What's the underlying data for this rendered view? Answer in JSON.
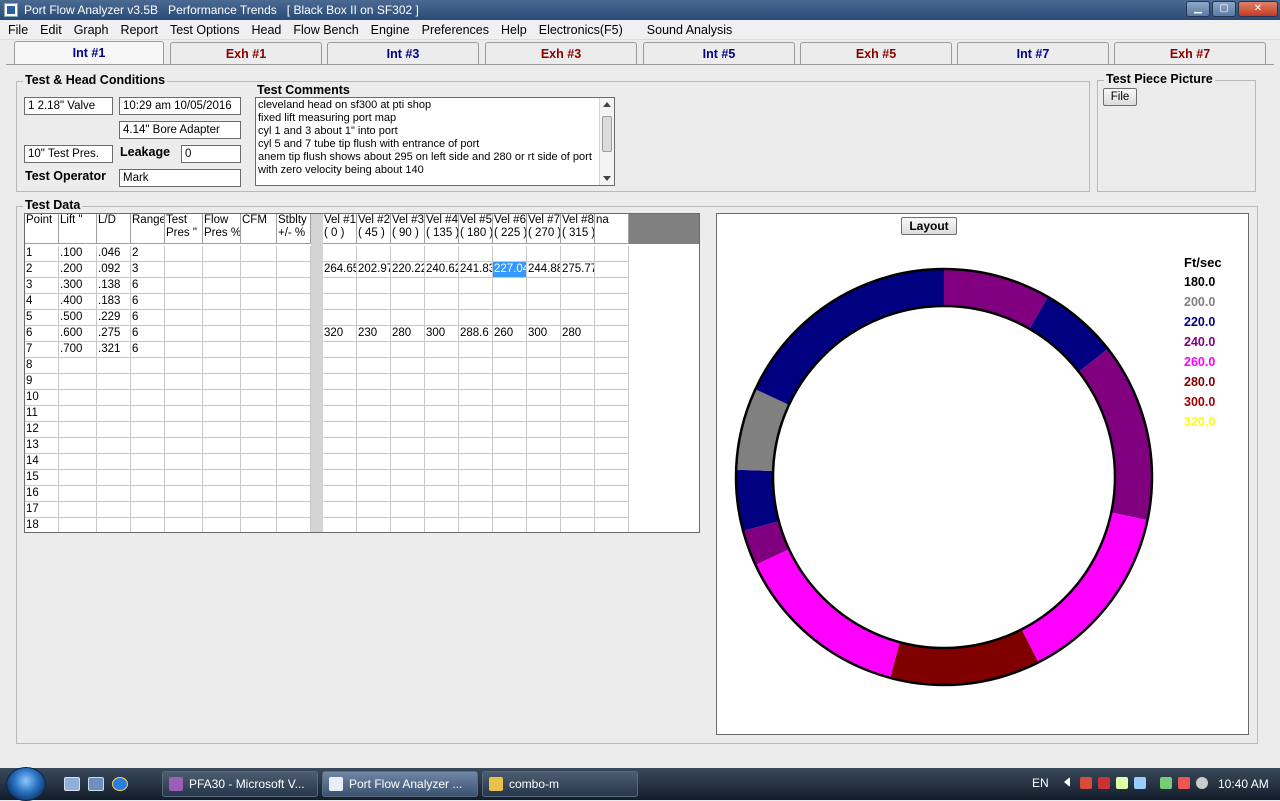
{
  "window": {
    "title": "Port Flow Analyzer v3.5B   Performance Trends   [ Black Box II on SF302 ]",
    "controls": {
      "minimize": "▁",
      "maximize": "▢",
      "close": "✕"
    }
  },
  "menu": [
    "File",
    "Edit",
    "Graph",
    "Report",
    "Test Options",
    "Head",
    "Flow Bench",
    "Engine",
    "Preferences",
    "Help",
    "Electronics(F5)",
    "Sound Analysis"
  ],
  "tabs": [
    {
      "label": "Int #1",
      "kind": "int"
    },
    {
      "label": "Exh #1",
      "kind": "exh"
    },
    {
      "label": "Int #3",
      "kind": "int"
    },
    {
      "label": "Exh #3",
      "kind": "exh"
    },
    {
      "label": "Int #5",
      "kind": "int"
    },
    {
      "label": "Exh #5",
      "kind": "exh"
    },
    {
      "label": "Int #7",
      "kind": "int"
    },
    {
      "label": "Exh #7",
      "kind": "exh"
    }
  ],
  "active_tab": "Int #1",
  "conditions": {
    "title": "Test & Head Conditions",
    "valve": "1  2.18\" Valve",
    "datetime": "10:29 am  10/05/2016",
    "bore_adapter": "4.14\" Bore Adapter",
    "test_pres": "10\" Test Pres.",
    "leakage_label": "Leakage",
    "leakage_value": "0",
    "operator_label": "Test Operator",
    "operator": "Mark"
  },
  "comments": {
    "title": "Test Comments",
    "lines": [
      "cleveland head on sf300 at pti shop",
      "fixed lift measuring port map",
      "cyl 1 and 3 about 1\" into port",
      "cyl 5 and 7 tube tip flush with entrance of port",
      "anem tip flush shows about 295 on left side and 280 or rt side of port",
      "with zero velocity being about 140"
    ]
  },
  "picture": {
    "title": "Test Piece Picture",
    "file_button": "File"
  },
  "test_data": {
    "title": "Test Data",
    "headers": [
      "Point",
      "Lift \"",
      "L/D",
      "Range",
      "Test\nPres \"",
      "Flow\nPres %",
      "CFM",
      "Stblty\n+/- %",
      "",
      "Vel #1\n( 0 )",
      "Vel #2\n( 45 )",
      "Vel #3\n( 90 )",
      "Vel #4\n( 135 )",
      "Vel #5\n( 180 )",
      "Vel #6\n( 225 )",
      "Vel #7\n( 270 )",
      "Vel #8\n( 315 )",
      "na"
    ],
    "rows": [
      [
        "1",
        ".100",
        ".046",
        "2",
        "",
        "",
        "",
        "",
        "",
        "",
        "",
        "",
        "",
        "",
        "",
        "",
        "",
        ""
      ],
      [
        "2",
        ".200",
        ".092",
        "3",
        "",
        "",
        "",
        "",
        "",
        "264.65",
        "202.97",
        "220.22",
        "240.62",
        "241.83",
        "227.04",
        "244.88",
        "275.77",
        ""
      ],
      [
        "3",
        ".300",
        ".138",
        "6",
        "",
        "",
        "",
        "",
        "",
        "",
        "",
        "",
        "",
        "",
        "",
        "",
        "",
        ""
      ],
      [
        "4",
        ".400",
        ".183",
        "6",
        "",
        "",
        "",
        "",
        "",
        "",
        "",
        "",
        "",
        "",
        "",
        "",
        "",
        ""
      ],
      [
        "5",
        ".500",
        ".229",
        "6",
        "",
        "",
        "",
        "",
        "",
        "",
        "",
        "",
        "",
        "",
        "",
        "",
        "",
        ""
      ],
      [
        "6",
        ".600",
        ".275",
        "6",
        "",
        "",
        "",
        "",
        "",
        "320",
        "230",
        "280",
        "300",
        "288.6",
        "260",
        "300",
        "280",
        ""
      ],
      [
        "7",
        ".700",
        ".321",
        "6",
        "",
        "",
        "",
        "",
        "",
        "",
        "",
        "",
        "",
        "",
        "",
        "",
        "",
        ""
      ],
      [
        "8",
        "",
        "",
        "",
        "",
        "",
        "",
        "",
        "",
        "",
        "",
        "",
        "",
        "",
        "",
        "",
        "",
        ""
      ],
      [
        "9",
        "",
        "",
        "",
        "",
        "",
        "",
        "",
        "",
        "",
        "",
        "",
        "",
        "",
        "",
        "",
        "",
        ""
      ],
      [
        "10",
        "",
        "",
        "",
        "",
        "",
        "",
        "",
        "",
        "",
        "",
        "",
        "",
        "",
        "",
        "",
        "",
        ""
      ],
      [
        "11",
        "",
        "",
        "",
        "",
        "",
        "",
        "",
        "",
        "",
        "",
        "",
        "",
        "",
        "",
        "",
        "",
        ""
      ],
      [
        "12",
        "",
        "",
        "",
        "",
        "",
        "",
        "",
        "",
        "",
        "",
        "",
        "",
        "",
        "",
        "",
        "",
        ""
      ],
      [
        "13",
        "",
        "",
        "",
        "",
        "",
        "",
        "",
        "",
        "",
        "",
        "",
        "",
        "",
        "",
        "",
        "",
        ""
      ],
      [
        "14",
        "",
        "",
        "",
        "",
        "",
        "",
        "",
        "",
        "",
        "",
        "",
        "",
        "",
        "",
        "",
        "",
        ""
      ],
      [
        "15",
        "",
        "",
        "",
        "",
        "",
        "",
        "",
        "",
        "",
        "",
        "",
        "",
        "",
        "",
        "",
        "",
        ""
      ],
      [
        "16",
        "",
        "",
        "",
        "",
        "",
        "",
        "",
        "",
        "",
        "",
        "",
        "",
        "",
        "",
        "",
        "",
        ""
      ],
      [
        "17",
        "",
        "",
        "",
        "",
        "",
        "",
        "",
        "",
        "",
        "",
        "",
        "",
        "",
        "",
        "",
        "",
        ""
      ],
      [
        "18",
        "",
        "",
        "",
        "",
        "",
        "",
        "",
        "",
        "",
        "",
        "",
        "",
        "",
        "",
        "",
        "",
        ""
      ]
    ],
    "selected_cell": {
      "row": 2,
      "column": "Vel #6"
    }
  },
  "port_map": {
    "layout_button": "Layout",
    "legend_title": "Ft/sec",
    "legend": [
      {
        "value": "180.0",
        "color": "#000000"
      },
      {
        "value": "200.0",
        "color": "#808080"
      },
      {
        "value": "220.0",
        "color": "#000080"
      },
      {
        "value": "240.0",
        "color": "#800080"
      },
      {
        "value": "260.0",
        "color": "#ff00ff"
      },
      {
        "value": "280.0",
        "color": "#800000"
      },
      {
        "value": "300.0",
        "color": "#a00000"
      },
      {
        "value": "320.0",
        "color": "#ffff00"
      }
    ],
    "ring_segments_clockwise_from_top_deg": [
      {
        "from": 292,
        "to": 350,
        "color": "#800080"
      },
      {
        "from": 350,
        "to": 390,
        "color": "#800080"
      },
      {
        "from": 390,
        "to": 412,
        "color": "#000080"
      },
      {
        "from": 412,
        "to": 462,
        "color": "#800080"
      },
      {
        "from": 462,
        "to": 513,
        "color": "#ff00ff"
      },
      {
        "from": 513,
        "to": 555,
        "color": "#800000"
      },
      {
        "from": 555,
        "to": 605,
        "color": "#ff00ff"
      },
      {
        "from": 605,
        "to": 615,
        "color": "#800080"
      },
      {
        "from": 615,
        "to": 632,
        "color": "#000080"
      },
      {
        "from": 632,
        "to": 655,
        "color": "#808080"
      },
      {
        "from": 655,
        "to": 720,
        "color": "#000080"
      }
    ]
  },
  "taskbar": {
    "items": [
      {
        "label": "PFA30 - Microsoft V...",
        "active": false
      },
      {
        "label": "Port Flow Analyzer ...",
        "active": true
      },
      {
        "label": "combo-m",
        "active": false
      }
    ],
    "language": "EN",
    "clock": "10:40 AM"
  }
}
